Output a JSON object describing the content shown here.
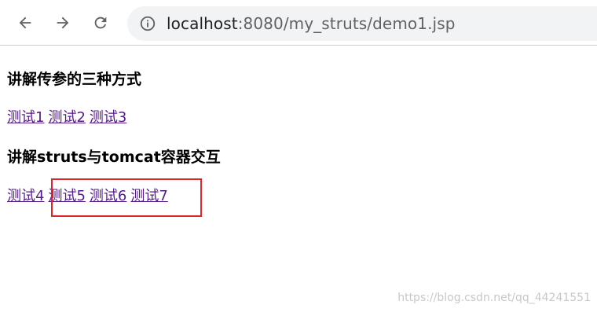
{
  "browser": {
    "back_icon": "arrow-left-icon",
    "forward_icon": "arrow-right-icon",
    "reload_icon": "reload-icon",
    "info_icon": "info-circle-icon",
    "url_host": "localhost",
    "url_rest": ":8080/my_struts/demo1.jsp"
  },
  "page": {
    "heading1": "讲解传参的三种方式",
    "links1": [
      "测试1",
      "测试2",
      "测试3"
    ],
    "heading2": "讲解struts与tomcat容器交互",
    "links2": [
      "测试4",
      "测试5",
      "测试6",
      "测试7"
    ]
  },
  "overlay": {
    "highlight_color": "#e0252a"
  },
  "watermark": "https://blog.csdn.net/qq_44241551"
}
